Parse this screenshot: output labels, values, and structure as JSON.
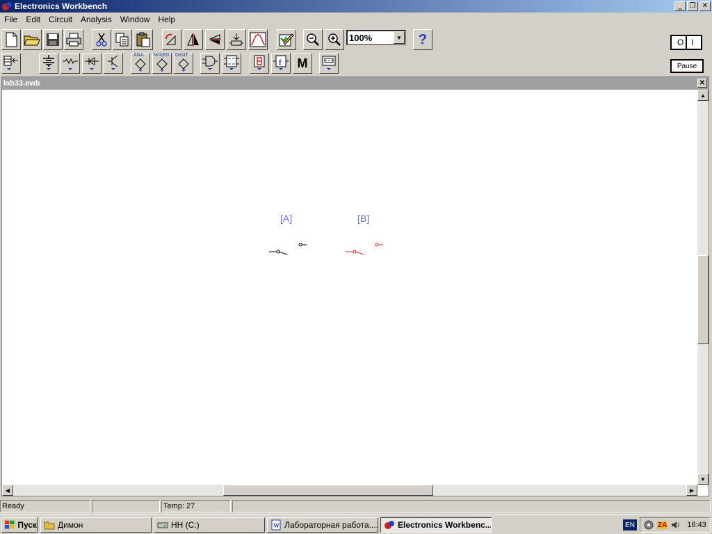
{
  "window": {
    "title": "Electronics Workbench",
    "controls": {
      "minimize": "_",
      "restore": "❐",
      "close": "✕"
    }
  },
  "menu": [
    "File",
    "Edit",
    "Circuit",
    "Analysis",
    "Window",
    "Help"
  ],
  "toolbar": {
    "zoom_value": "100%",
    "help_label": "?",
    "pause_label": "Pause",
    "power_off_label": "O",
    "power_on_label": "I",
    "bin_labels": {
      "analog": "ANA",
      "mixed": "MIXED",
      "digital": "DIGIT",
      "misc": "M"
    }
  },
  "document": {
    "title": "lab33.ewb",
    "close": "✕",
    "components": [
      {
        "label": "[A]",
        "color": "#000000"
      },
      {
        "label": "[B]",
        "color": "#e02020"
      }
    ],
    "label_color": "#7070ff"
  },
  "statusbar": {
    "message": "Ready",
    "cell2": "",
    "temp": "Temp:  27",
    "cell4": ""
  },
  "taskbar": {
    "start_label": "Пуск",
    "tasks": [
      {
        "label": "Димон"
      },
      {
        "label": "HH (C:)"
      },
      {
        "label": "Лабораторная работа...."
      },
      {
        "label": "Electronics Workbenc..."
      }
    ],
    "language": "EN",
    "tray_za": "ZA",
    "clock": "16:43"
  }
}
